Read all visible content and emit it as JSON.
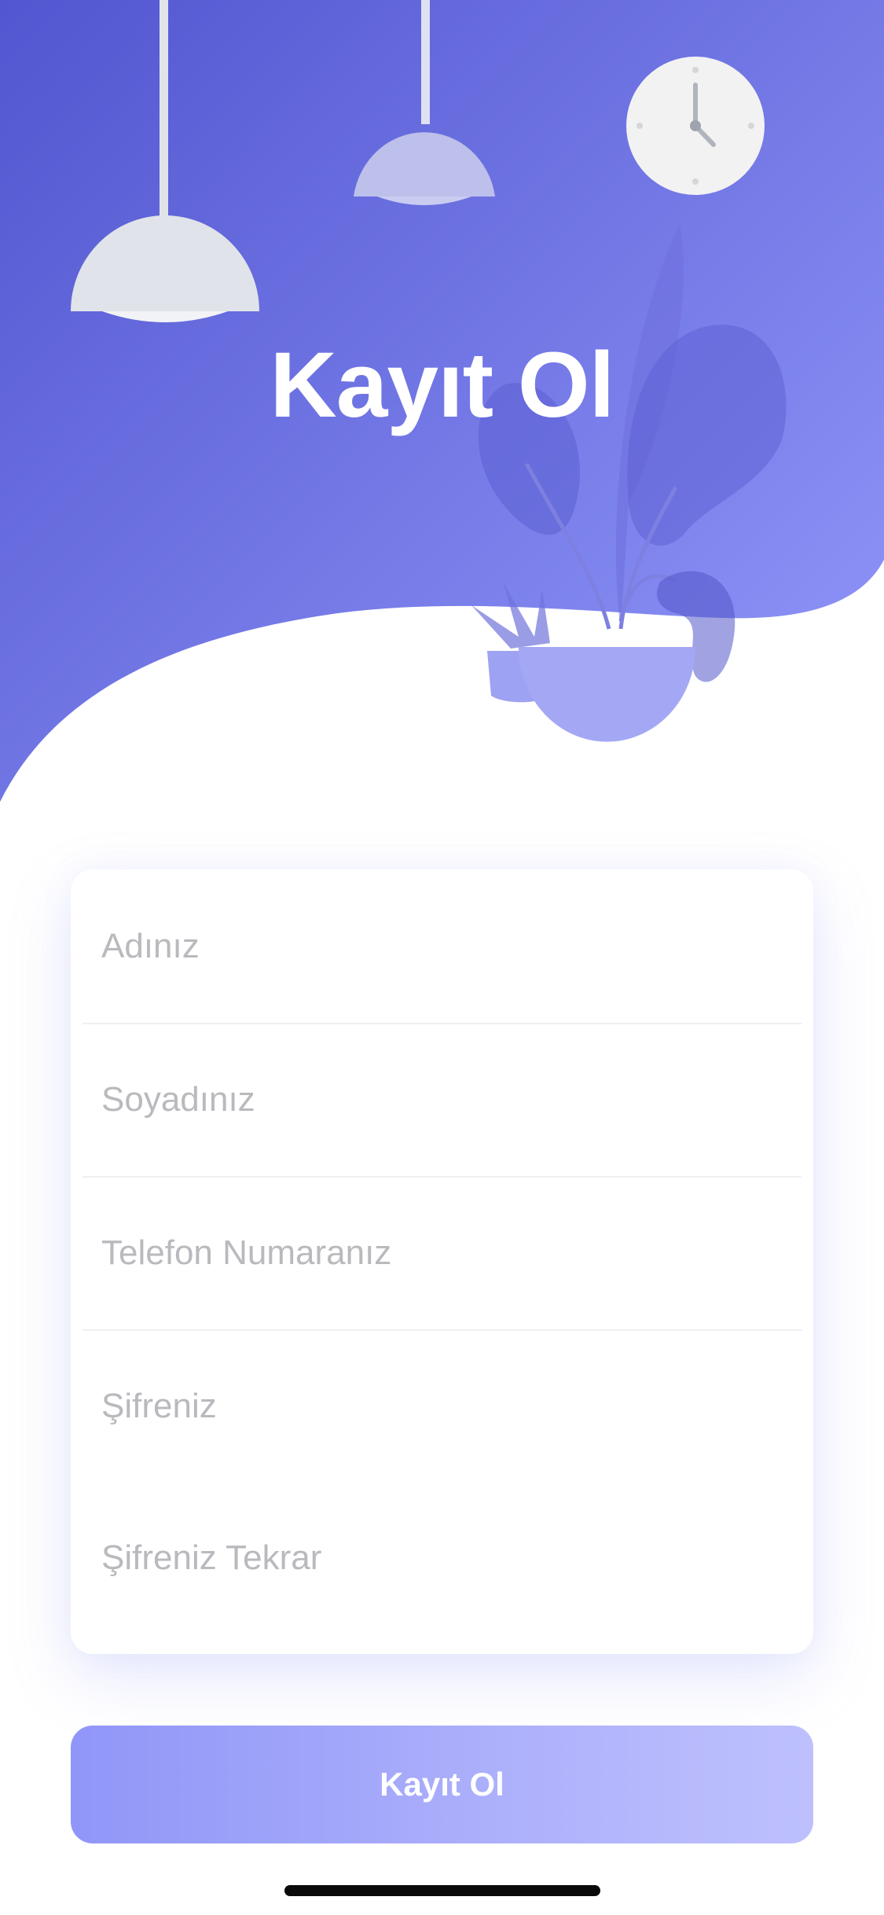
{
  "header": {
    "title": "Kayıt Ol"
  },
  "form": {
    "fields": [
      {
        "placeholder": "Adınız",
        "value": ""
      },
      {
        "placeholder": "Soyadınız",
        "value": ""
      },
      {
        "placeholder": "Telefon Numaranız",
        "value": ""
      },
      {
        "placeholder": "Şifreniz",
        "value": ""
      },
      {
        "placeholder": "Şifreniz Tekrar",
        "value": ""
      }
    ]
  },
  "submit": {
    "label": "Kayıt Ol"
  },
  "colors": {
    "hero_gradient_start": "#5256d0",
    "hero_gradient_end": "#8f95f8",
    "button_gradient_start": "#9096f8",
    "button_gradient_end": "#bec0fd",
    "placeholder": "#b9b9be"
  },
  "illustration": {
    "icons": [
      "pendant-lamp-icon",
      "wall-clock-icon",
      "potted-plant-icon"
    ]
  }
}
